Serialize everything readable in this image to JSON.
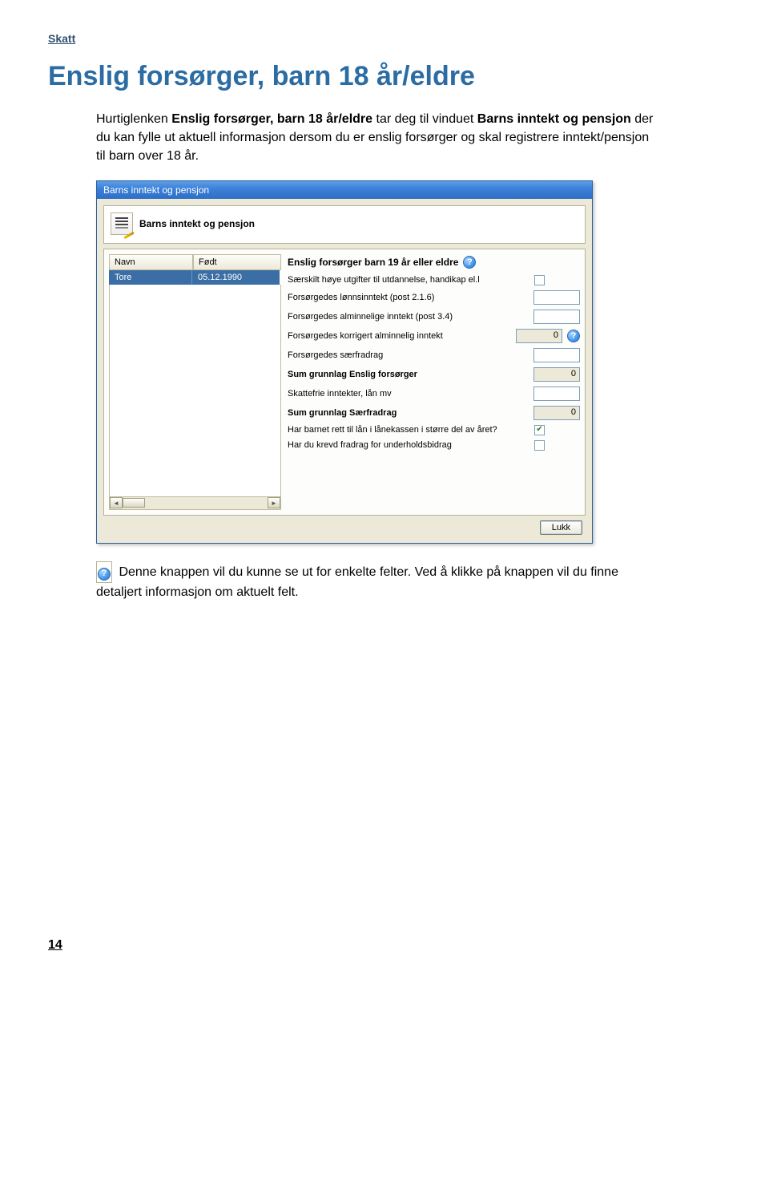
{
  "page": {
    "header_label": "Skatt",
    "title": "Enslig forsørger, barn 18 år/eldre",
    "intro_part1": "Hurtiglenken ",
    "intro_bold1": "Enslig forsørger, barn 18 år/eldre",
    "intro_part2": " tar deg til vinduet ",
    "intro_bold2": "Barns inntekt og pensjon",
    "intro_part3": " der du kan fylle ut aktuell informasjon dersom du er enslig forsørger og skal registrere inntekt/pensjon til barn over 18 år.",
    "page_number": "14"
  },
  "dialog": {
    "titlebar": "Barns inntekt og pensjon",
    "banner_title": "Barns inntekt og pensjon",
    "grid": {
      "header_name": "Navn",
      "header_born": "Født",
      "row_name": "Tore",
      "row_born": "05.12.1990",
      "scroll_left": "◄",
      "scroll_right": "►"
    },
    "form": {
      "title": "Enslig forsørger barn 19 år eller eldre",
      "rows": [
        {
          "label": "Særskilt høye utgifter til utdannelse, handikap el.l",
          "type": "checkbox",
          "checked": false
        },
        {
          "label": "Forsørgedes lønnsinntekt (post 2.1.6)",
          "type": "field",
          "value": ""
        },
        {
          "label": "Forsørgedes alminnelige inntekt (post 3.4)",
          "type": "field",
          "value": ""
        },
        {
          "label": "Forsørgedes korrigert alminnelig inntekt",
          "type": "field_ro_help",
          "value": "0"
        },
        {
          "label": "Forsørgedes særfradrag",
          "type": "field",
          "value": ""
        },
        {
          "label": "Sum grunnlag Enslig forsørger",
          "type": "field_ro",
          "bold": true,
          "value": "0"
        },
        {
          "label": "Skattefrie inntekter, lån mv",
          "type": "field",
          "value": ""
        },
        {
          "label": "Sum grunnlag Særfradrag",
          "type": "field_ro",
          "bold": true,
          "value": "0"
        },
        {
          "label": "Har barnet rett til lån i lånekassen i større del av året?",
          "type": "checkbox",
          "checked": true
        },
        {
          "label": "Har du krevd fradrag for underholdsbidrag",
          "type": "checkbox",
          "checked": false
        }
      ]
    },
    "close_btn": "Lukk"
  },
  "note": {
    "text": " Denne knappen vil du kunne se ut for enkelte felter. Ved å klikke på knappen vil du finne detaljert informasjon om aktuelt felt."
  }
}
